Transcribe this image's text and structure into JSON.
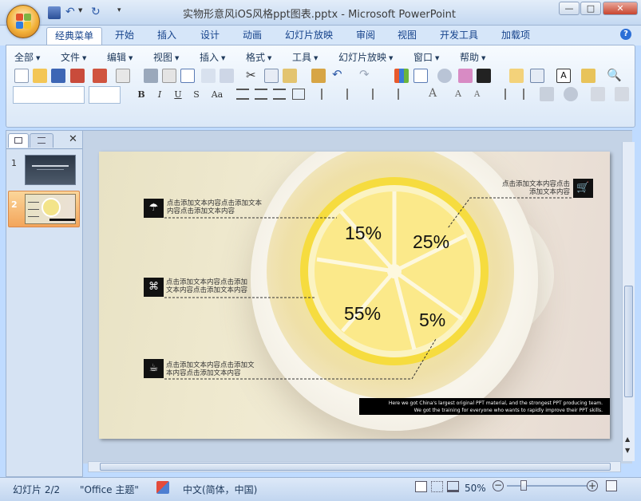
{
  "window": {
    "title": "实物形意风iOS风格ppt图表.pptx - Microsoft PowerPoint",
    "minimize": "—",
    "maximize": "□",
    "close": "✕"
  },
  "ribbon_tabs": [
    "经典菜单",
    "开始",
    "插入",
    "设计",
    "动画",
    "幻灯片放映",
    "审阅",
    "视图",
    "开发工具",
    "加载项"
  ],
  "help": "?",
  "classic_menu": [
    "全部",
    "文件",
    "编辑",
    "视图",
    "插入",
    "格式",
    "工具",
    "幻灯片放映",
    "窗口",
    "帮助"
  ],
  "format_buttons": [
    "B",
    "I",
    "U",
    "S",
    "Aa"
  ],
  "slides_panel": {
    "close": "✕",
    "items": [
      {
        "number": "1"
      },
      {
        "number": "2"
      }
    ]
  },
  "slide": {
    "percentages": [
      "15%",
      "25%",
      "55%",
      "5%"
    ],
    "label_tl_line1": "点击添加文本内容点击添加文本",
    "label_tl_line2": "内容点击添加文本内容",
    "label_ml_line1": "点击添加文本内容点击添加",
    "label_ml_line2": "文本内容点击添加文本内容",
    "label_bl_line1": "点击添加文本内容点击添加文",
    "label_bl_line2": "本内容点击添加文本内容",
    "label_tr_line1": "点击添加文本内容点击",
    "label_tr_line2": "添加文本内容",
    "footer_line1": "Here we got China's largest original PPT material, and the strongest PPT producing team.",
    "footer_line2": "We got the training for everyone who wants to rapidly improve their PPT skills."
  },
  "status": {
    "slide_counter": "幻灯片 2/2",
    "theme": "\"Office 主题\"",
    "language": "中文(简体，中国)",
    "zoom": "50%"
  },
  "colors": {
    "accent": "#15428b",
    "ribbon_bg": "#dbe8f7",
    "selected_thumb": "#f7b365"
  }
}
